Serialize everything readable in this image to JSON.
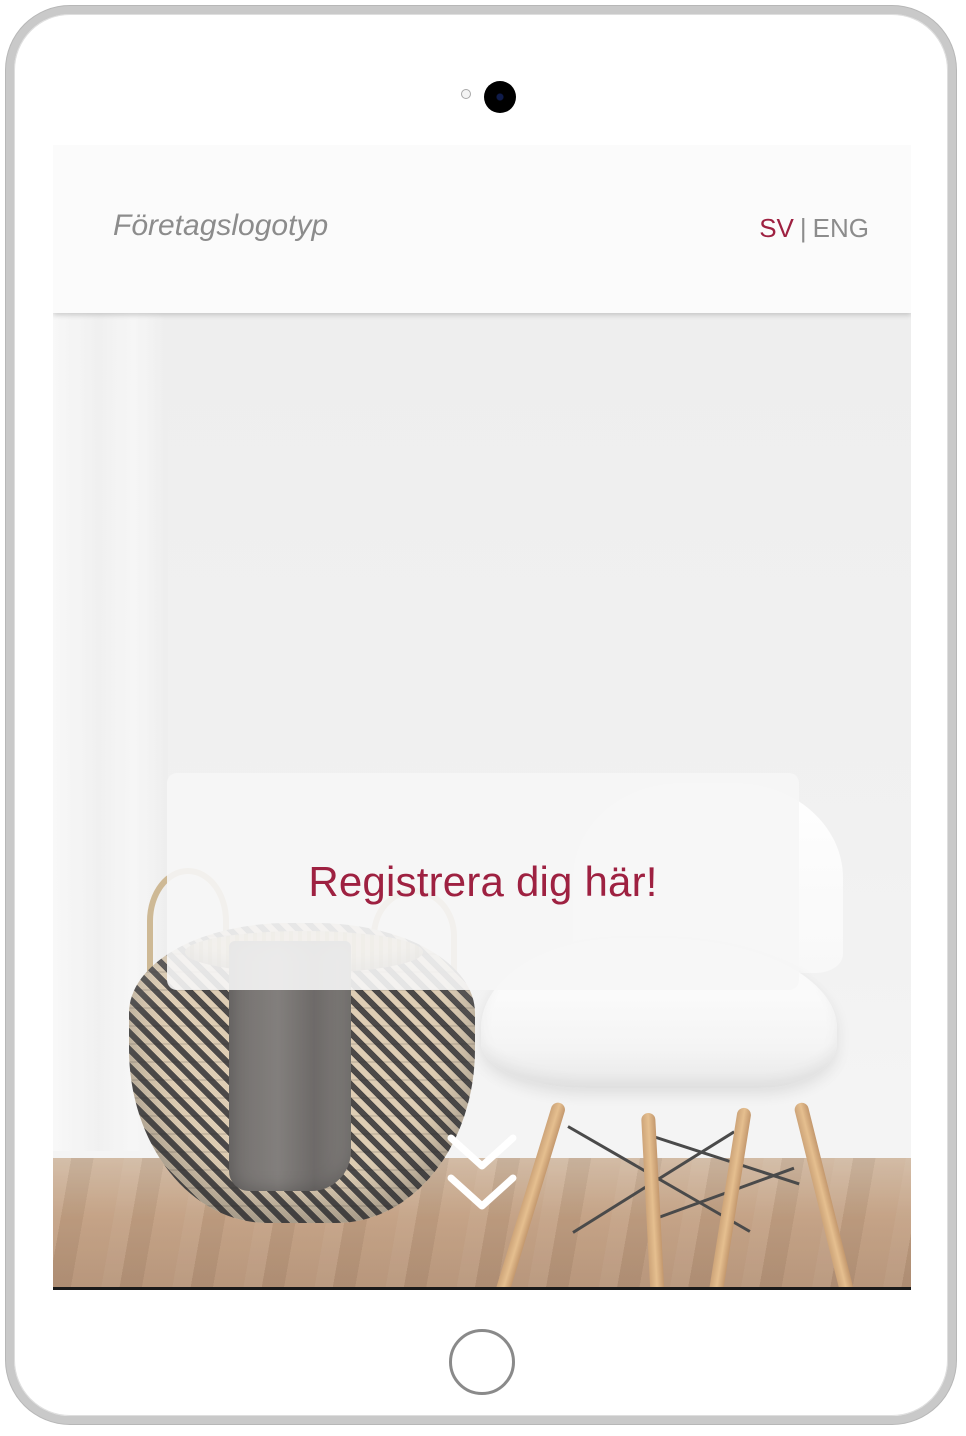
{
  "header": {
    "logo_text": "Företagslogotyp",
    "language": {
      "active": "SV",
      "separator": "|",
      "inactive": "ENG"
    }
  },
  "hero": {
    "cta_label": "Registrera dig här!",
    "scroll_icon": "double-chevron-down-icon"
  },
  "device": {
    "frame": "tablet",
    "home_button_icon": "home-button-icon",
    "camera_icon": "camera-icon"
  },
  "colors": {
    "accent": "#9e2141",
    "muted_text": "#8c8c8c",
    "header_bg": "#fbfbfb",
    "frame": "#c9c9c9"
  }
}
